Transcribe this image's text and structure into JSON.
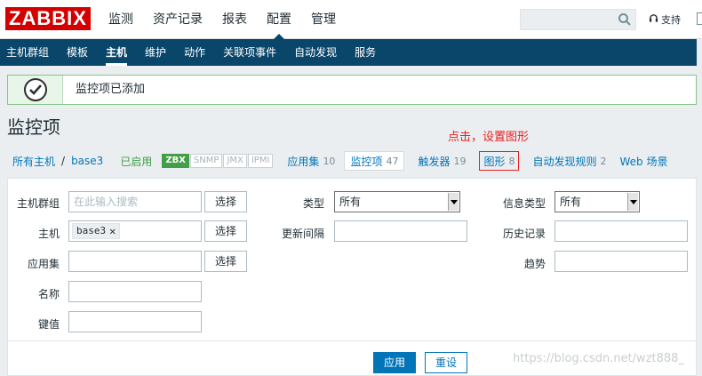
{
  "logo": "ZABBIX",
  "top_menu": [
    "监测",
    "资产记录",
    "报表",
    "配置",
    "管理"
  ],
  "top_menu_active": "配置",
  "support_label": "支持",
  "sub_nav": [
    "主机群组",
    "模板",
    "主机",
    "维护",
    "动作",
    "关联项事件",
    "自动发现",
    "服务"
  ],
  "sub_nav_active": "主机",
  "message": "监控项已添加",
  "page_title": "监控项",
  "annotation": "点击，设置图形",
  "breadcrumb": {
    "all_hosts": "所有主机",
    "separator": "/",
    "host": "base3",
    "status": "已启用"
  },
  "availability": [
    "ZBX",
    "SNMP",
    "JMX",
    "IPMI"
  ],
  "tabs": {
    "applications": {
      "label": "应用集",
      "count": "10"
    },
    "items": {
      "label": "监控项",
      "count": "47"
    },
    "triggers": {
      "label": "触发器",
      "count": "19"
    },
    "graphs": {
      "label": "图形",
      "count": "8"
    },
    "discovery": {
      "label": "自动发现规则",
      "count": "2"
    },
    "web": {
      "label": "Web 场景"
    }
  },
  "filter": {
    "host_groups_label": "主机群组",
    "host_groups_placeholder": "在此输入搜索",
    "select_label": "选择",
    "host_label": "主机",
    "host_chip": "base3",
    "application_label": "应用集",
    "name_label": "名称",
    "key_label": "键值",
    "type_label": "类型",
    "type_value": "所有",
    "update_interval_label": "更新间隔",
    "info_type_label": "信息类型",
    "info_type_value": "所有",
    "history_label": "历史记录",
    "trends_label": "趋势",
    "apply_label": "应用",
    "reset_label": "重设"
  },
  "watermark": "https://blog.csdn.net/wzt888_",
  "colors": {
    "brand": "#d40000",
    "nav": "#0a466a",
    "link": "#0275b8",
    "success": "#429e47",
    "annotation": "#e81f1f"
  }
}
